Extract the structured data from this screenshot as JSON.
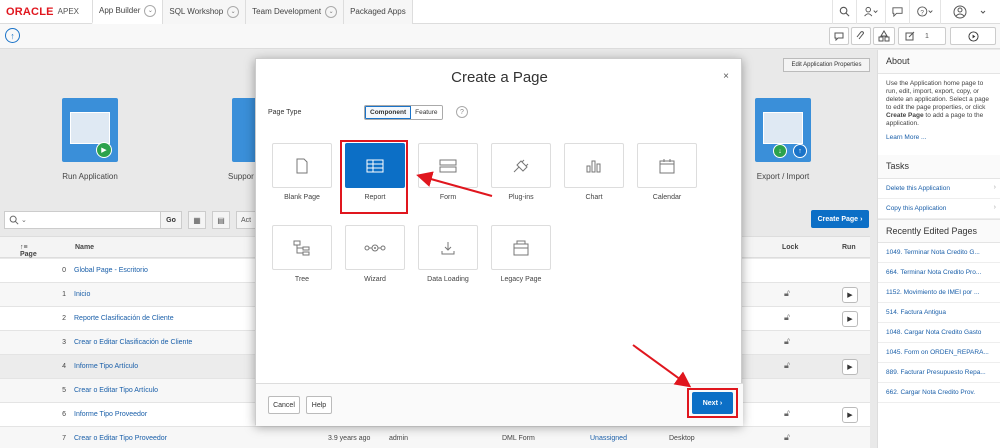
{
  "topbar": {
    "logo_brand": "ORACLE",
    "logo_product": "APEX",
    "tabs": [
      {
        "label": "App Builder"
      },
      {
        "label": "SQL Workshop"
      },
      {
        "label": "Team Development"
      },
      {
        "label": "Packaged Apps"
      }
    ],
    "help_label": "?"
  },
  "toolbar2": {
    "edit_app_props": "Edit Application Properties",
    "counter": "1"
  },
  "dashboard": {
    "run_application": "Run Application",
    "supporting": "Suppor",
    "export_import": "Export / Import"
  },
  "search": {
    "placeholder": "",
    "go_label": "Go",
    "actions_label": "Act",
    "create_page_label": "Create Page"
  },
  "table": {
    "headers": {
      "page": "Page",
      "name": "Name",
      "lock": "Lock",
      "run": "Run"
    },
    "rows": [
      {
        "page": "0",
        "name": "Global Page - Escritorio"
      },
      {
        "page": "1",
        "name": "Inicio"
      },
      {
        "page": "2",
        "name": "Reporte Clasificación de Cliente"
      },
      {
        "page": "3",
        "name": "Crear o Editar Clasificación de Cliente"
      },
      {
        "page": "4",
        "name": "Informe Tipo Artículo"
      },
      {
        "page": "5",
        "name": "Crear o Editar Tipo Artículo"
      },
      {
        "page": "6",
        "name": "Informe Tipo Proveedor"
      },
      {
        "page": "7",
        "name": "Crear o Editar Tipo Proveedor",
        "updated": "3.9 years ago",
        "by": "admin",
        "type": "DML Form",
        "group": "Unassigned",
        "ui": "Desktop"
      }
    ]
  },
  "sidebar": {
    "about_title": "About",
    "about_text_1": "Use the Application home page to run, edit, import, export, copy, or delete an application. Select a page to edit the page properties, or click ",
    "about_text_bold": "Create Page",
    "about_text_2": " to add a page to the application.",
    "learn_more": "Learn More ...",
    "tasks_title": "Tasks",
    "tasks": [
      "Delete this Application",
      "Copy this Application"
    ],
    "recent_title": "Recently Edited Pages",
    "recent": [
      "1049. Terminar Nota Credito G...",
      "664. Terminar Nota Credito Pro...",
      "1152. Movimiento de IMEI por ...",
      "514. Factura Antigua",
      "1048. Cargar Nota Credito Gasto",
      "1045. Form on ORDEN_REPARA...",
      "889. Facturar Presupuesto Repa...",
      "662. Cargar Nota Credito Prov."
    ]
  },
  "dialog": {
    "title": "Create a Page",
    "close_label": "×",
    "page_type_label": "Page Type",
    "seg_component": "Component",
    "seg_feature": "Feature",
    "help_label": "?",
    "tiles": [
      {
        "label": "Blank Page"
      },
      {
        "label": "Report"
      },
      {
        "label": "Form"
      },
      {
        "label": "Plug-ins"
      },
      {
        "label": "Chart"
      },
      {
        "label": "Calendar"
      },
      {
        "label": "Tree"
      },
      {
        "label": "Wizard"
      },
      {
        "label": "Data Loading"
      },
      {
        "label": "Legacy Page"
      }
    ],
    "cancel_label": "Cancel",
    "help_btn_label": "Help",
    "next_label": "Next"
  },
  "colors": {
    "accent": "#0c6fc6",
    "oracle_red": "#e0161e",
    "highlight": "#e0161e"
  }
}
